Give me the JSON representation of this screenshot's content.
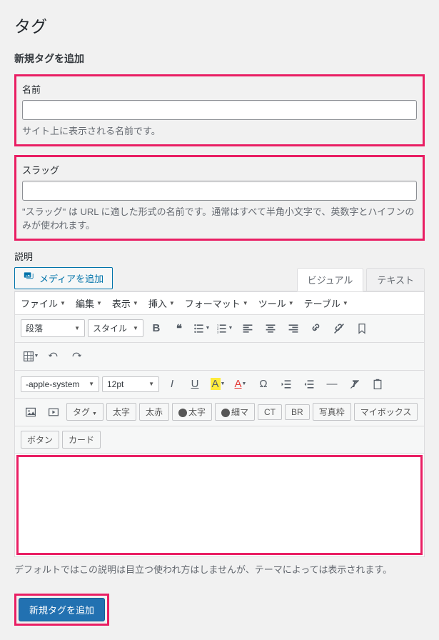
{
  "page": {
    "title": "タグ",
    "form_title": "新規タグを追加"
  },
  "fields": {
    "name": {
      "label": "名前",
      "value": "",
      "desc": "サイト上に表示される名前です。"
    },
    "slug": {
      "label": "スラッグ",
      "value": "",
      "desc": "\"スラッグ\" は URL に適した形式の名前です。通常はすべて半角小文字で、英数字とハイフンのみが使われます。"
    },
    "description": {
      "label": "説明",
      "desc": "デフォルトではこの説明は目立つ使われ方はしませんが、テーマによっては表示されます。"
    }
  },
  "media_button": "メディアを追加",
  "editor": {
    "tabs": {
      "visual": "ビジュアル",
      "text": "テキスト"
    },
    "menubar": {
      "file": "ファイル",
      "edit": "編集",
      "view": "表示",
      "insert": "挿入",
      "format": "フォーマット",
      "tools": "ツール",
      "table": "テーブル"
    },
    "format_select": "段落",
    "style_select": "スタイル",
    "font_select": "-apple-system",
    "size_select": "12pt",
    "buttons": {
      "tag": "タグ",
      "bold_jp": "太字",
      "red_bold": "太赤",
      "marker_bold": "太字",
      "marker_thin": "細マ",
      "ct": "CT",
      "br": "BR",
      "photo_frame": "写真枠",
      "mybox": "マイボックス",
      "button": "ボタン",
      "card": "カード"
    }
  },
  "submit": "新規タグを追加"
}
